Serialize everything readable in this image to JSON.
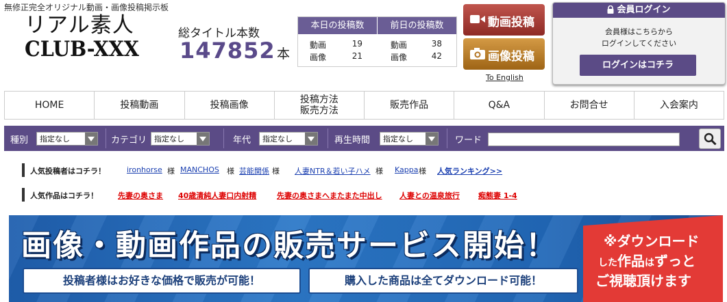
{
  "header": {
    "tagline": "無修正完全オリジナル動画・画像投稿掲示板",
    "logo_line1": "リアル素人",
    "logo_line2": "CLUB-XXX",
    "total_label": "総タイトル本数",
    "total_count": "147852",
    "total_unit": "本"
  },
  "stats": {
    "today_header": "本日の投稿数",
    "yesterday_header": "前日の投稿数",
    "video_label": "動画",
    "image_label": "画像",
    "today_video": "19",
    "today_image": "21",
    "yesterday_video": "38",
    "yesterday_image": "42"
  },
  "buttons": {
    "post_video": "動画投稿",
    "post_image": "画像投稿",
    "to_english": "To English"
  },
  "login": {
    "title": "会員ログイン",
    "message_line1": "会員様はこちらから",
    "message_line2": "ログインしてください",
    "button": "ログインはコチラ"
  },
  "nav": {
    "items": [
      {
        "label": "HOME"
      },
      {
        "label": "投稿動画"
      },
      {
        "label": "投稿画像"
      },
      {
        "label_line1": "投稿方法",
        "label_line2": "販売方法"
      },
      {
        "label": "販売作品"
      },
      {
        "label": "Q&A"
      },
      {
        "label": "お問合せ"
      },
      {
        "label": "入会案内"
      }
    ]
  },
  "search": {
    "type_label": "種別",
    "type_value": "指定なし",
    "category_label": "カテゴリ",
    "category_value": "指定なし",
    "age_label": "年代",
    "age_value": "指定なし",
    "duration_label": "再生時間",
    "duration_value": "指定なし",
    "word_label": "ワード",
    "word_value": ""
  },
  "popular_posters": {
    "title": "人気投稿者はコチラ！",
    "honorific": "様",
    "names": [
      "ironhorse",
      "MANCHOS",
      "芸能関係",
      "人妻NTR＆若い子ハメ",
      "Kappa"
    ],
    "ranking_link": "人気ランキング>>"
  },
  "popular_works": {
    "title": "人気作品はコチラ！",
    "items": [
      "先妻の奥さま",
      "40歳清純人妻口内射精",
      "先妻の奥さまへまたまた中出し",
      "人妻との温泉旅行",
      "痴態妻 1-4"
    ]
  },
  "banner": {
    "headline": "画像・動画作品の販売サービス開始！",
    "pill1": "投稿者様はお好きな価格で販売が可能！",
    "pill2": "購入した商品は全てダウンロード可能！",
    "note_line1": "※ダウンロード",
    "note_line2a": "した",
    "note_line2b": "作品",
    "note_line2c": "は",
    "note_line2d": "ずっと",
    "note_line3": "ご視聴頂けます"
  },
  "colors": {
    "brand_purple": "#5b4b86",
    "video_button": "#a83a33",
    "image_button": "#c07f2c",
    "link_red": "#dd0000",
    "link_blue": "#1a3fb0"
  }
}
